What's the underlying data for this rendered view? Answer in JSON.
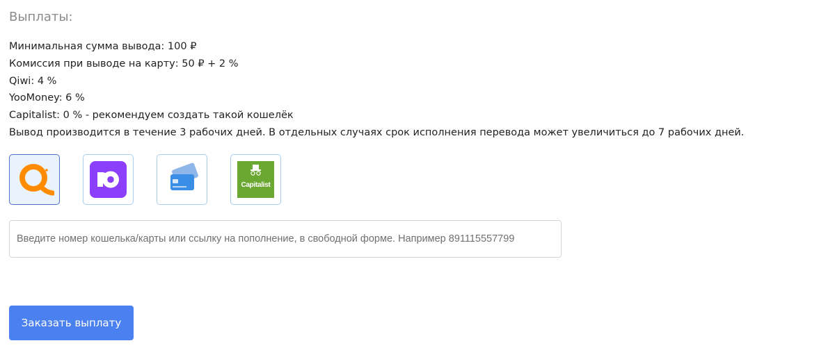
{
  "heading": "Выплаты:",
  "info": {
    "min_amount": "Минимальная сумма вывода: 100 ₽",
    "card_fee": "Комиссия при выводе на карту: 50 ₽ + 2 %",
    "qiwi_fee": "Qiwi: 4 %",
    "yoomoney_fee": "YooMoney: 6 %",
    "capitalist_fee": "Capitalist: 0 % - рекомендуем создать такой кошелёк",
    "processing_time": "Вывод производится в течение 3 рабочих дней. В отдельных случаях срок исполнения перевода может увеличиться до 7 рабочих дней."
  },
  "methods": [
    {
      "id": "qiwi",
      "icon": "qiwi-logo-icon",
      "selected": true,
      "color": "#ff8c00"
    },
    {
      "id": "yoomoney",
      "icon": "yoomoney-logo-icon",
      "selected": false,
      "color": "#8b3ffd"
    },
    {
      "id": "card",
      "icon": "bank-card-icon",
      "selected": false,
      "color": "#3a8ee6"
    },
    {
      "id": "capitalist",
      "icon": "capitalist-logo-icon",
      "selected": false,
      "color": "#6aa832",
      "logo_text": "Capitalist"
    }
  ],
  "wallet_input": {
    "value": "",
    "placeholder": "Введите номер кошелька/карты или ссылку на пополнение, в свободной форме. Например 891115557799"
  },
  "submit_label": "Заказать выплату",
  "colors": {
    "accent": "#4a80f0",
    "heading": "#8a8a8a",
    "method_border": "#a9cdf0",
    "method_selected_bg": "#eaf2fb"
  }
}
